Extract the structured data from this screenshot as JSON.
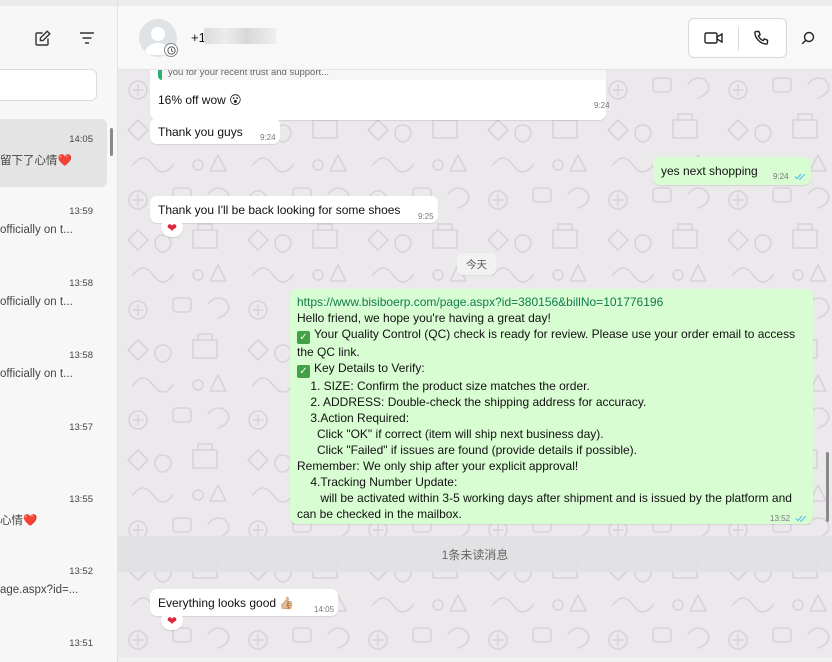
{
  "sidebar": {
    "search_placeholder": "",
    "chats": [
      {
        "time": "14:05",
        "preview": "留下了心情❤️"
      },
      {
        "time": "13:59",
        "preview": "officially on t..."
      },
      {
        "time": "13:58",
        "preview": "officially on t..."
      },
      {
        "time": "13:58",
        "preview": "officially on t..."
      },
      {
        "time": "13:57",
        "preview": ""
      },
      {
        "time": "13:55",
        "preview": "心情❤️"
      },
      {
        "time": "13:52",
        "preview": "age.aspx?id=..."
      },
      {
        "time": "13:51",
        "preview": ""
      }
    ]
  },
  "header": {
    "contact_name": "+1"
  },
  "chat": {
    "quoted_snippet": "you for your recent trust and support...",
    "messages": {
      "m1": {
        "text": "16% off wow 😮",
        "time": "9:24"
      },
      "m2": {
        "text": "Thank you guys",
        "time": "9:24"
      },
      "m3": {
        "text": "yes next shopping",
        "time": "9:24"
      },
      "m4": {
        "text": "Thank you I'll be back looking for some shoes",
        "time": "9:25",
        "reaction": "❤"
      },
      "m6": {
        "text": "Everything looks good 👍🏼",
        "time": "14:05",
        "reaction": "❤"
      }
    },
    "day_label": "今天",
    "unread_label": "1条未读消息",
    "big_message": {
      "time": "13:52",
      "lines": [
        "https://www.bisiboerp.com/page.aspx?id=380156&billNo=101776196",
        "Hello friend, we hope you're having a great day!",
        "Your Quality Control (QC) check is ready for review. Please use your order email to access",
        "the QC link.",
        "Key Details to Verify:",
        "    1. SIZE: Confirm the product size matches the order.",
        "    2. ADDRESS: Double-check the shipping address for accuracy.",
        "    3.Action Required:",
        "      Click \"OK\" if correct (item will ship next business day).",
        "      Click \"Failed\" if issues are found (provide details if possible).",
        "Remember: We only ship after your explicit approval!",
        "    4.Tracking Number Update:",
        "       will be activated within 3-5 working days after shipment and is issued by the platform and",
        "can be checked in the mailbox."
      ]
    }
  },
  "colors": {
    "outgoing_bubble": "#d9fdd3",
    "link": "#0f7b4d",
    "quote_accent": "#26b36b",
    "read_tick": "#53bdeb",
    "reaction_heart": "#e0243b"
  }
}
